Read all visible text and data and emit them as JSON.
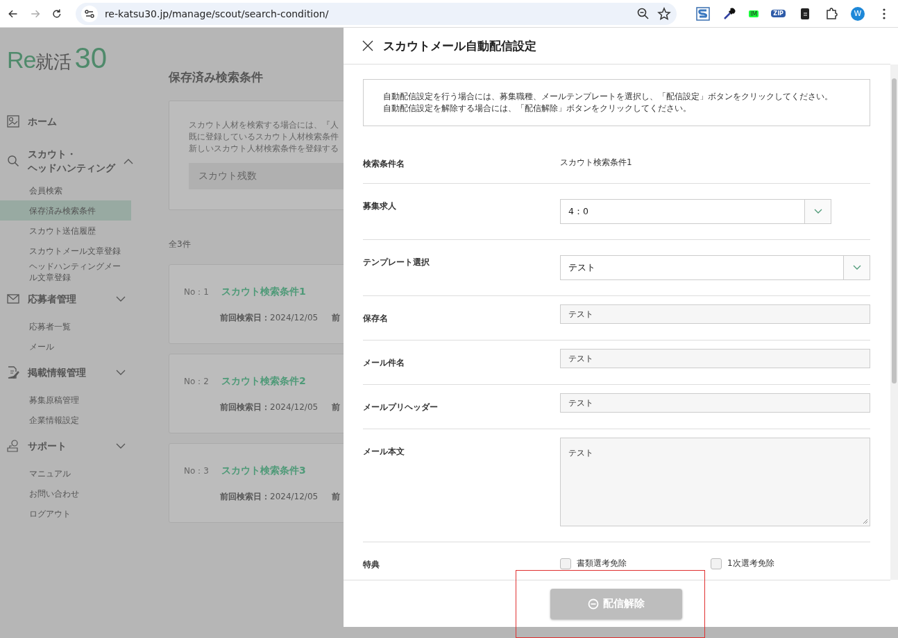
{
  "browser": {
    "url": "re-katsu30.jp/manage/scout/search-condition/",
    "extension_badges": [
      "IM",
      "ZIP"
    ],
    "profile_initial": "W"
  },
  "sidebar": {
    "logo": {
      "latin": "Re",
      "kanji": "就活",
      "number": "30"
    },
    "sections": [
      {
        "kind": "link",
        "label_lines": [
          "ホーム"
        ]
      },
      {
        "kind": "group",
        "label_lines": [
          "スカウト・",
          "ヘッドハンティング"
        ],
        "expanded": true,
        "items": [
          {
            "label": "会員検索",
            "selected": false
          },
          {
            "label": "保存済み検索条件",
            "selected": true
          },
          {
            "label": "スカウト送信履歴",
            "selected": false
          },
          {
            "label": "スカウトメール文章登録",
            "selected": false
          },
          {
            "label": "ヘッドハンティングメール文章登録",
            "selected": false
          }
        ]
      },
      {
        "kind": "group",
        "label_lines": [
          "応募者管理"
        ],
        "expanded": false,
        "items": [
          {
            "label": "応募者一覧",
            "selected": false
          },
          {
            "label": "メール",
            "selected": false
          }
        ]
      },
      {
        "kind": "group",
        "label_lines": [
          "掲載情報管理"
        ],
        "expanded": false,
        "items": [
          {
            "label": "募集原稿管理",
            "selected": false
          },
          {
            "label": "企業情報設定",
            "selected": false
          }
        ]
      },
      {
        "kind": "group",
        "label_lines": [
          "サポート"
        ],
        "expanded": false,
        "items": [
          {
            "label": "マニュアル",
            "selected": false
          },
          {
            "label": "お問い合わせ",
            "selected": false
          },
          {
            "label": "ログアウト",
            "selected": false
          }
        ]
      }
    ]
  },
  "main": {
    "title": "保存済み検索条件",
    "notice_lines": [
      "スカウト人材を検索する場合には、『人",
      "既に登録しているスカウト人材検索条件",
      "新しいスカウト人材検索条件を登録する"
    ],
    "remaining_label": "スカウト残数",
    "total": "全3件",
    "cards": [
      {
        "no": "No：1",
        "name": "スカウト検索条件1",
        "last_search": "**前回検索日：**2024/12/05",
        "column_2": "前"
      },
      {
        "no": "No：2",
        "name": "スカウト検索条件2",
        "last_search": "**前回検索日：**2024/12/05",
        "column_2": "前"
      },
      {
        "no": "No：3",
        "name": "スカウト検索条件3",
        "last_search": "**前回検索日：**2024/12/05",
        "column_2": "前"
      }
    ]
  },
  "modal": {
    "title": "スカウトメール自動配信設定",
    "notice_lines": [
      "自動配信設定を行う場合には、募集職種、メールテンプレートを選択し、「配信設定」ボタンをクリックしてください。",
      "自動配信設定を解除する場合には、「配信解除」ボタンをクリックしてください。"
    ],
    "fields": [
      {
        "kind": "text",
        "label": "検索条件名",
        "value": "スカウト検索条件1"
      },
      {
        "kind": "select",
        "label": "募集求人",
        "value": "4：0",
        "narrow": true
      },
      {
        "kind": "select",
        "label": "テンプレート選択",
        "value": "テスト",
        "narrow": false
      },
      {
        "kind": "input",
        "label": "保存名",
        "value": "テスト"
      },
      {
        "kind": "input",
        "label": "メール件名",
        "value": "テスト"
      },
      {
        "kind": "input",
        "label": "メールプリヘッダー",
        "value": "テスト"
      },
      {
        "kind": "textarea",
        "label": "メール本文",
        "value": "テスト"
      },
      {
        "kind": "checkboxes",
        "label": "特典",
        "options": [
          {
            "label": "書類選考免除",
            "checked": false
          },
          {
            "label": "1次選考免除",
            "checked": false
          }
        ]
      }
    ],
    "button": {
      "label": "配信解除",
      "disabled": true
    }
  }
}
